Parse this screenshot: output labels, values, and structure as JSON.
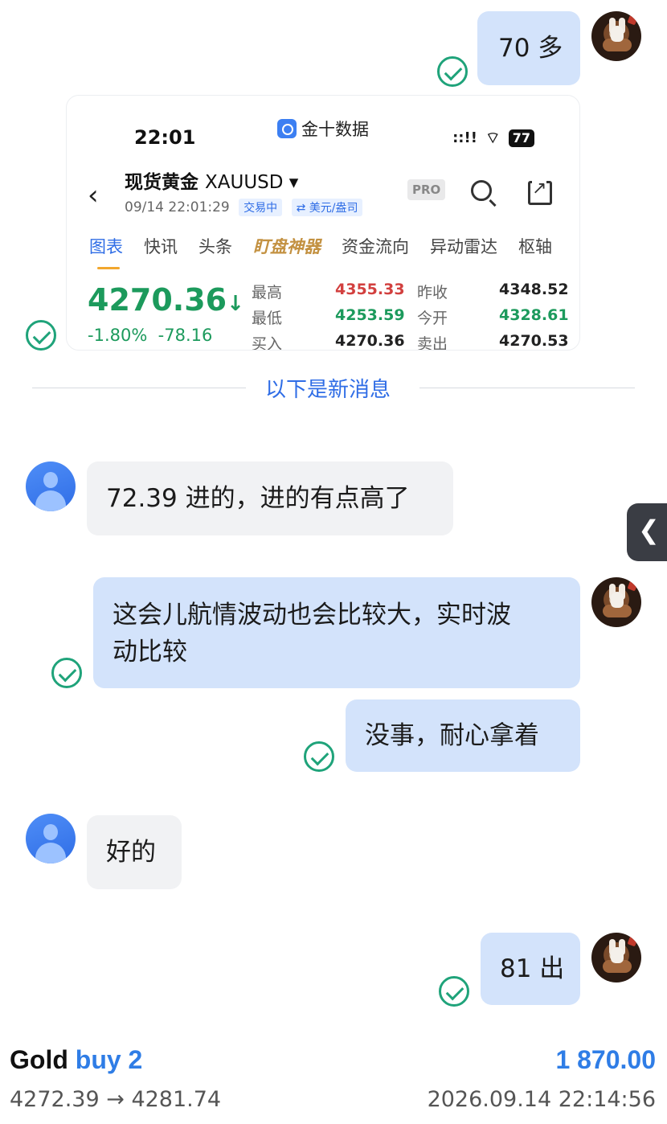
{
  "chat": {
    "msg1": "70 多",
    "divider_label": "以下是新消息",
    "msg2": "72.39 进的，进的有点高了",
    "msg3_line1": "这会儿航情波动也会比较大，实时波",
    "msg3_line2": "动比较",
    "msg4": "没事，耐心拿着",
    "msg5": "好的",
    "msg6": "81 出"
  },
  "quote_card": {
    "status_time": "22:01",
    "app_name": "金十数据",
    "signal": "::!!",
    "battery": "77",
    "instrument": "现货黄金",
    "symbol": "XAUUSD ▾",
    "datetime": "09/14 22:01:29",
    "badge_trading": "交易中",
    "badge_currency": "⇄ 美元/盎司",
    "pro_label": "PRO",
    "tabs": [
      "图表",
      "快讯",
      "头条",
      "盯盘神器",
      "资金流向",
      "异动雷达",
      "枢轴"
    ],
    "price": "4270.36",
    "price_arrow": "↓",
    "change_pct": "-1.80%",
    "change_abs": "-78.16",
    "stats": {
      "high_label": "最高",
      "high": "4355.33",
      "low_label": "最低",
      "low": "4253.59",
      "buy_label": "买入",
      "buy": "4270.36",
      "prev_close_label": "昨收",
      "prev_close": "4348.52",
      "open_label": "今开",
      "open": "4328.61",
      "sell_label": "卖出",
      "sell": "4270.53"
    },
    "colors": {
      "up": "#d2403f",
      "down": "#1c9a5c",
      "accent": "#2f6de6"
    }
  },
  "trade_footer": {
    "asset": "Gold",
    "action": "buy 2",
    "profit": "1 870.00",
    "prices": "4272.39 → 4281.74",
    "timestamp": "2026.09.14 22:14:56"
  }
}
